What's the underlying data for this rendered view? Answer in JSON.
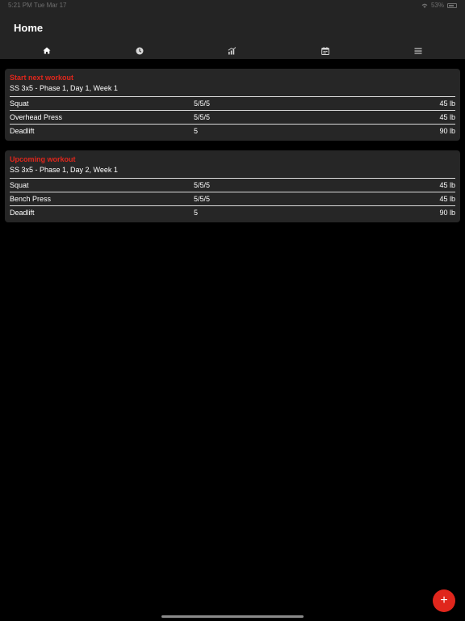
{
  "status_bar": {
    "time_date": "5:21 PM  Tue Mar 17",
    "battery": "53%"
  },
  "header": {
    "title": "Home"
  },
  "tabs": [
    {
      "icon": "home-icon",
      "active": true
    },
    {
      "icon": "clock-icon",
      "active": false
    },
    {
      "icon": "chart-icon",
      "active": false
    },
    {
      "icon": "calendar-icon",
      "active": false
    },
    {
      "icon": "menu-icon",
      "active": false
    }
  ],
  "next_workout": {
    "heading": "Start next workout",
    "subtitle": "SS 3x5 - Phase 1, Day 1, Week 1",
    "rows": [
      {
        "name": "Squat",
        "reps": "5/5/5",
        "weight": "45 lb"
      },
      {
        "name": "Overhead Press",
        "reps": "5/5/5",
        "weight": "45 lb"
      },
      {
        "name": "Deadlift",
        "reps": "5",
        "weight": "90 lb"
      }
    ]
  },
  "upcoming_workout": {
    "heading": "Upcoming workout",
    "subtitle": "SS 3x5 - Phase 1, Day 2, Week 1",
    "rows": [
      {
        "name": "Squat",
        "reps": "5/5/5",
        "weight": "45 lb"
      },
      {
        "name": "Bench Press",
        "reps": "5/5/5",
        "weight": "45 lb"
      },
      {
        "name": "Deadlift",
        "reps": "5",
        "weight": "90 lb"
      }
    ]
  },
  "fab": {
    "label": "+"
  },
  "colors": {
    "accent": "#e0261c",
    "header_bg": "#242424",
    "card_bg": "#262626",
    "background": "#000000"
  }
}
